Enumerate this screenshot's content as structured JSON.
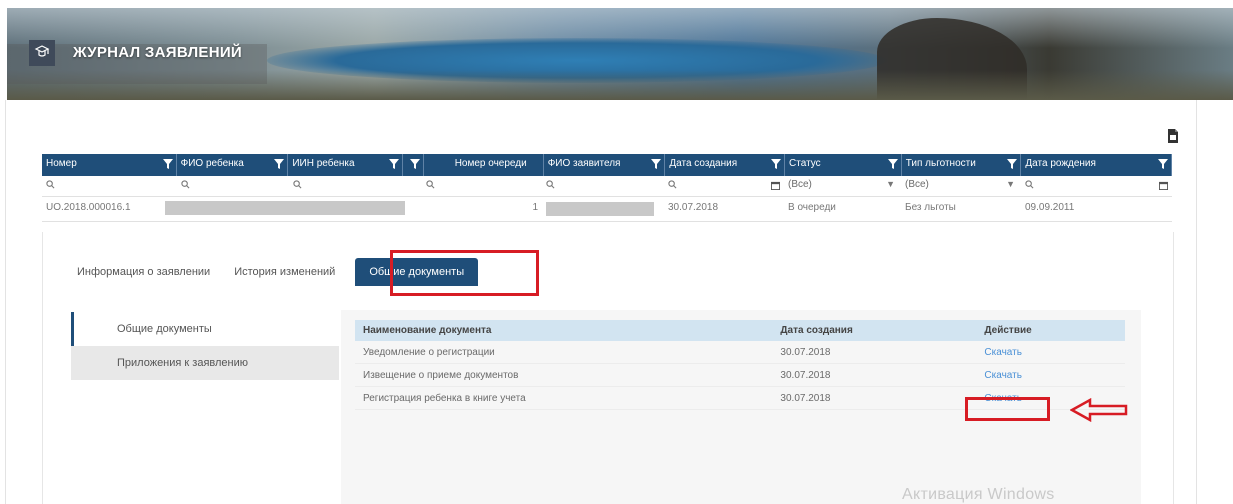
{
  "header": {
    "title": "ЖУРНАЛ ЗАЯВЛЕНИЙ"
  },
  "grid": {
    "columns": [
      "Номер",
      "ФИО ребенка",
      "ИИН ребенка",
      "",
      "Номер очереди",
      "ФИО заявителя",
      "Дата создания",
      "Статус",
      "Тип льготности",
      "Дата рождения"
    ],
    "filters": {
      "status": "(Все)",
      "benefit": "(Все)"
    },
    "row": {
      "number": "UO.2018.000016.1",
      "queue_number": "1",
      "created": "30.07.2018",
      "status": "В очереди",
      "benefit": "Без льготы",
      "birth_date": "09.09.2011"
    }
  },
  "tabs": [
    "Информация о заявлении",
    "История изменений",
    "Общие документы"
  ],
  "sidenav": [
    "Общие документы",
    "Приложения к заявлению"
  ],
  "documents": {
    "headers": {
      "name": "Наименование документа",
      "date": "Дата создания",
      "action": "Действие"
    },
    "rows": [
      {
        "name": "Уведомление о регистрации",
        "date": "30.07.2018",
        "action": "Скачать"
      },
      {
        "name": "Извещение о приеме документов",
        "date": "30.07.2018",
        "action": "Скачать"
      },
      {
        "name": "Регистрация ребенка в книге учета",
        "date": "30.07.2018",
        "action": "Скачать"
      }
    ]
  },
  "watermark": "Активация Windows",
  "colors": {
    "header_blue": "#1f4e79",
    "highlight_red": "#d71c24",
    "link_blue": "#4a90d6"
  }
}
